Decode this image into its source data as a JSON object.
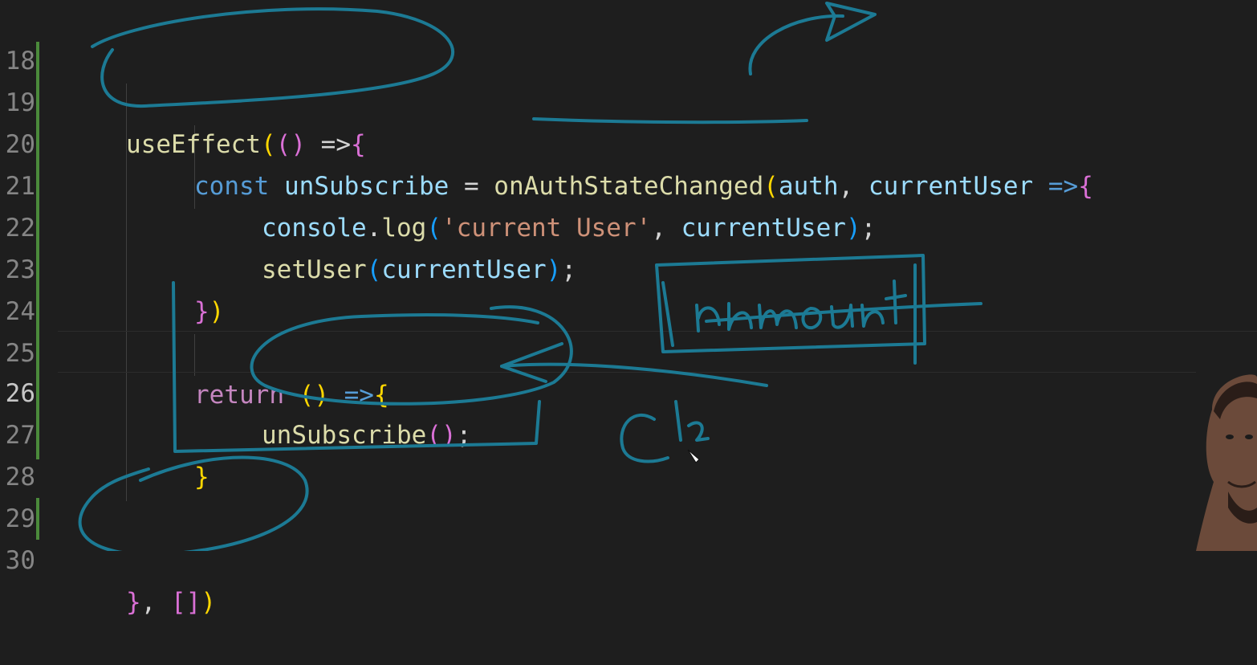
{
  "editor": {
    "line_numbers": [
      "18",
      "19",
      "20",
      "21",
      "22",
      "23",
      "24",
      "25",
      "26",
      "27",
      "28",
      "29",
      "30"
    ],
    "active_line": "26",
    "lines": {
      "l19": {
        "fn": "useEffect",
        "open": "((",
        "close": ")",
        "arrow": " =>",
        "brace": "{"
      },
      "l20": {
        "kw": "const",
        "name": " unSubscribe",
        "eq": " = ",
        "fn": "onAuthStateChanged",
        "open": "(",
        "arg1": "auth",
        "comma": ", ",
        "arg2": "currentUser",
        "arrow": " =>",
        "brace": "{"
      },
      "l21": {
        "obj": "console",
        "dot": ".",
        "fn": "log",
        "open": "(",
        "str": "'current User'",
        "comma": ", ",
        "arg": "currentUser",
        "close": ")",
        "semi": ";"
      },
      "l22": {
        "fn": "setUser",
        "open": "(",
        "arg": "currentUser",
        "close": ")",
        "semi": ";"
      },
      "l23": {
        "brace": "}",
        "paren": ")"
      },
      "l25": {
        "kw": "return",
        "space": " ",
        "parens": "()",
        "arrow": " =>",
        "brace": "{"
      },
      "l26": {
        "fn": "unSubscribe",
        "parens": "()",
        "semi": ";"
      },
      "l27": {
        "brace": "}"
      },
      "l30": {
        "brace": "}",
        "comma": ", ",
        "arr": "[]",
        "close": ")"
      }
    }
  },
  "annotations": {
    "handwriting_1": "unmount",
    "handwriting_2": "Cl2",
    "ink_color": "#1c7a94"
  }
}
